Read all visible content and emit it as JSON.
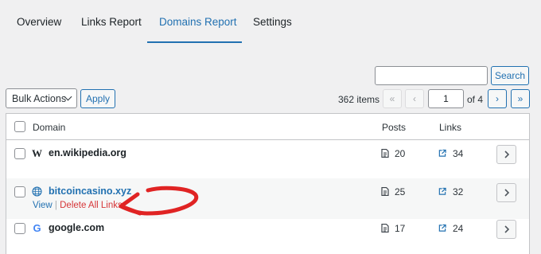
{
  "tabs": [
    {
      "label": "Overview"
    },
    {
      "label": "Links Report"
    },
    {
      "label": "Domains Report"
    },
    {
      "label": "Settings"
    }
  ],
  "active_tab": "Domains Report",
  "search": {
    "button_label": "Search",
    "value": ""
  },
  "bulk": {
    "selected": "Bulk Actions",
    "apply_label": "Apply"
  },
  "pagination": {
    "items_text": "362 items",
    "first": "«",
    "prev": "‹",
    "current": "1",
    "of_text": "of 4",
    "next": "›",
    "last": "»"
  },
  "table": {
    "columns": {
      "domain": "Domain",
      "posts": "Posts",
      "links": "Links"
    },
    "rows": [
      {
        "domain": "en.wikipedia.org",
        "icon": "wikipedia-icon",
        "posts": "20",
        "links": "34"
      },
      {
        "domain": "bitcoincasino.xyz",
        "icon": "globe-icon",
        "posts": "25",
        "links": "32",
        "actions": {
          "view": "View",
          "separator": "|",
          "delete": "Delete All Links"
        }
      },
      {
        "domain": "google.com",
        "icon": "google-icon",
        "posts": "17",
        "links": "24"
      }
    ]
  },
  "colors": {
    "accent": "#2271b1",
    "danger": "#d63638",
    "annotation_arrow": "#e02424"
  }
}
